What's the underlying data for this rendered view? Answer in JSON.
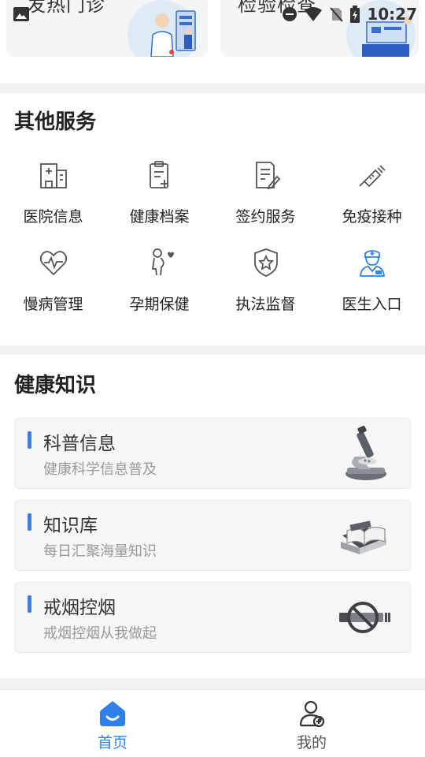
{
  "status_bar": {
    "time": "10:27"
  },
  "top_cards": [
    {
      "title": "发热门诊"
    },
    {
      "title": "检验检查"
    }
  ],
  "services": {
    "title": "其他服务",
    "items": [
      {
        "label": "医院信息",
        "icon": "hospital-icon"
      },
      {
        "label": "健康档案",
        "icon": "health-record-icon"
      },
      {
        "label": "签约服务",
        "icon": "contract-icon"
      },
      {
        "label": "免疫接种",
        "icon": "vaccine-icon"
      },
      {
        "label": "慢病管理",
        "icon": "heart-pulse-icon"
      },
      {
        "label": "孕期保健",
        "icon": "pregnancy-icon"
      },
      {
        "label": "执法监督",
        "icon": "shield-star-icon"
      },
      {
        "label": "医生入口",
        "icon": "doctor-icon"
      }
    ]
  },
  "knowledge": {
    "title": "健康知识",
    "cards": [
      {
        "title": "科普信息",
        "subtitle": "健康科学信息普及",
        "image": "microscope-image"
      },
      {
        "title": "知识库",
        "subtitle": "每日汇聚海量知识",
        "image": "books-image"
      },
      {
        "title": "戒烟控烟",
        "subtitle": "戒烟控烟从我做起",
        "image": "no-smoking-image"
      }
    ]
  },
  "accent_color": "#2f80ed",
  "bottom_nav": {
    "home_label": "首页",
    "mine_label": "我的"
  }
}
